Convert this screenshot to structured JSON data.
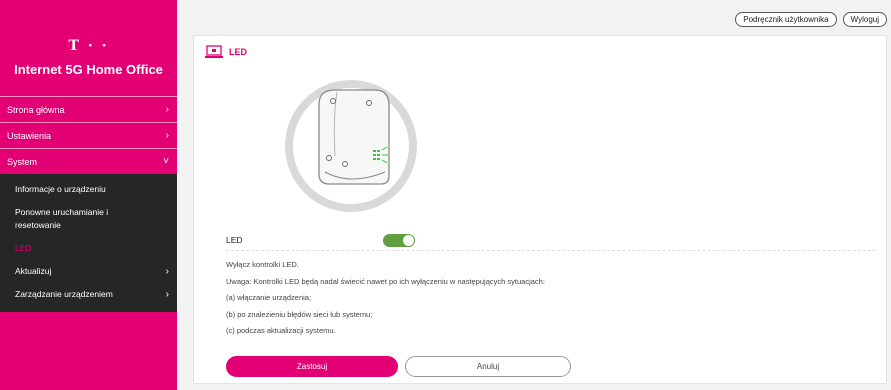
{
  "brand": {
    "logo_mark": "T · ·",
    "title": "Internet 5G Home Office"
  },
  "nav": {
    "items": [
      {
        "label": "Strona główna",
        "chevron": "›"
      },
      {
        "label": "Ustawienia",
        "chevron": "›"
      },
      {
        "label": "System",
        "chevron": "˅"
      }
    ],
    "system_sub": [
      {
        "label": "Informacje o urządzeniu",
        "chevron": ""
      },
      {
        "label": "Ponowne uruchamianie i resetowanie",
        "chevron": ""
      },
      {
        "label": "LED",
        "chevron": ""
      },
      {
        "label": "Aktualizuj",
        "chevron": "›"
      },
      {
        "label": "Zarządzanie urządzeniem",
        "chevron": "›"
      }
    ]
  },
  "topbar": {
    "manual": "Podręcznik użytkownika",
    "logout": "Wyloguj"
  },
  "card": {
    "title": "LED",
    "setting_label": "LED",
    "toggle_on": true,
    "desc": [
      "Wyłącz kontrolki LED.",
      "Uwaga: Kontrolki LED będą nadal świecić nawet po ich wyłączeniu w następujących sytuacjach:",
      "(a) włączanie urządzenia;",
      "(b) po znalezieniu błędów sieci lub systemu;",
      "(c) podczas aktualizacji systemu."
    ],
    "apply": "Zastosuj",
    "cancel": "Anuluj"
  },
  "colors": {
    "accent": "#e20074",
    "toggle": "#5f9f3f",
    "led": "#3cc23c"
  },
  "icons": {
    "card": "monitor-icon",
    "chevron": "chevron-right-icon",
    "device": "router-illustration"
  }
}
